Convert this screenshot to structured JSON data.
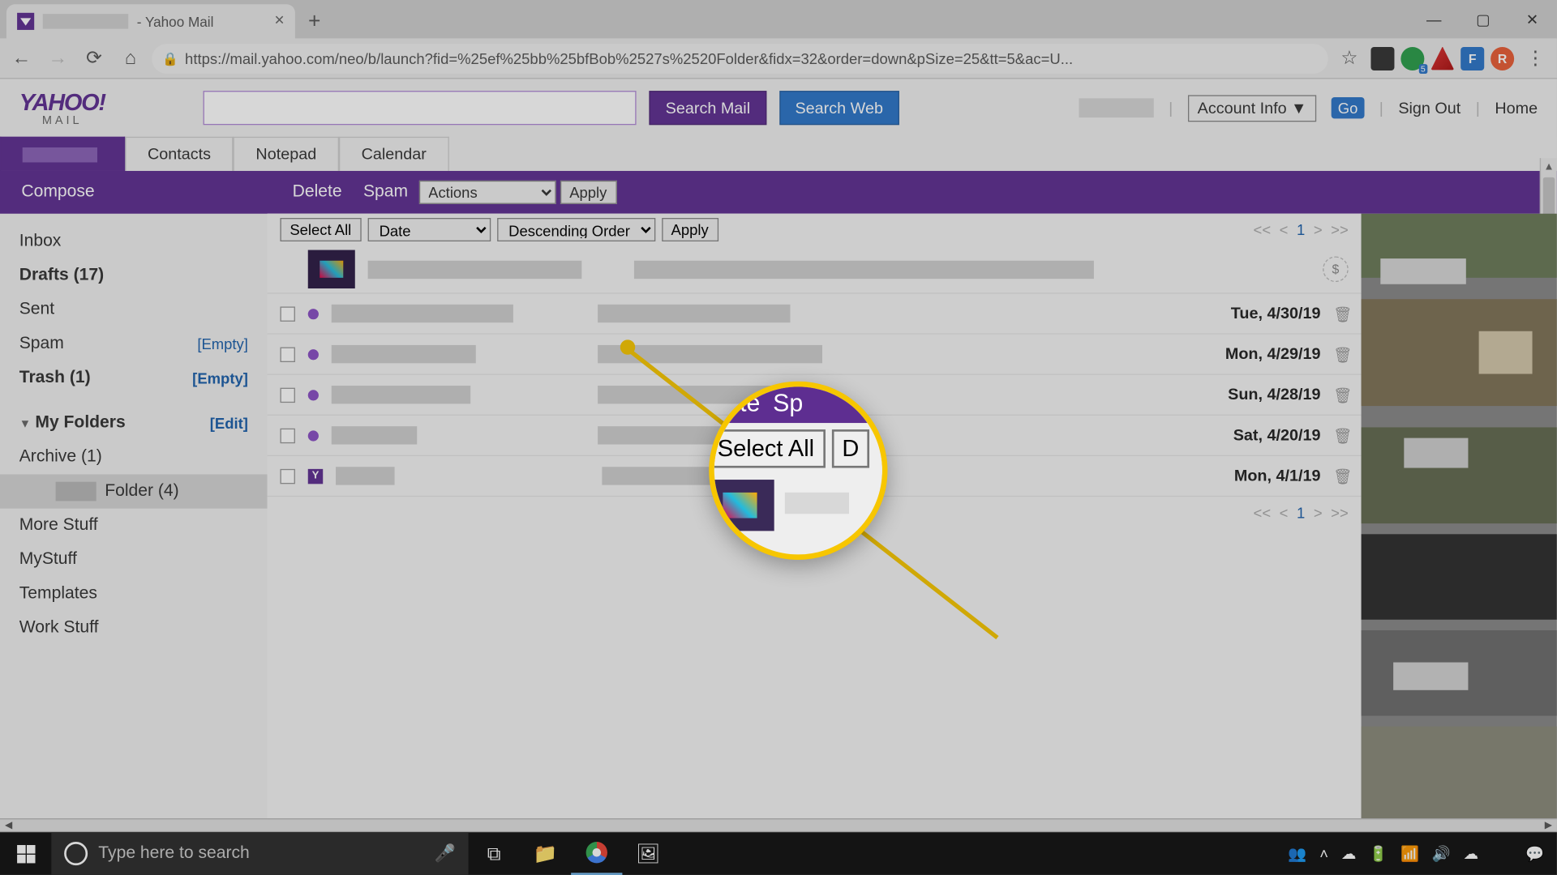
{
  "browser": {
    "tab_title": "- Yahoo Mail",
    "url": "https://mail.yahoo.com/neo/b/launch?fid=%25ef%25bb%25bfBob%2527s%2520Folder&fidx=32&order=down&pSize=25&tt=5&ac=U..."
  },
  "header": {
    "logo_top": "YAHOO!",
    "logo_bottom": "MAIL",
    "search_mail": "Search Mail",
    "search_web": "Search Web",
    "account_info": "Account Info",
    "go": "Go",
    "sign_out": "Sign Out",
    "home": "Home"
  },
  "tabs": {
    "contacts": "Contacts",
    "notepad": "Notepad",
    "calendar": "Calendar"
  },
  "purple_bar": {
    "compose": "Compose",
    "delete": "Delete",
    "spam": "Spam",
    "actions": "Actions",
    "apply": "Apply"
  },
  "sidebar": {
    "inbox": "Inbox",
    "drafts": "Drafts",
    "drafts_count": "(17)",
    "sent": "Sent",
    "spam": "Spam",
    "trash": "Trash",
    "trash_count": "(1)",
    "empty": "[Empty]",
    "my_folders": "My Folders",
    "edit": "[Edit]",
    "archive": "Archive (1)",
    "folder": "Folder (4)",
    "more_stuff": "More Stuff",
    "mystuff": "MyStuff",
    "templates": "Templates",
    "work_stuff": "Work Stuff"
  },
  "list_toolbar": {
    "select_all": "Select All",
    "sort_field": "Date",
    "sort_order": "Descending Order",
    "apply": "Apply"
  },
  "pager": {
    "first": "<<",
    "prev": "<",
    "page": "1",
    "next": ">",
    "last": ">>"
  },
  "messages": [
    {
      "date": ""
    },
    {
      "date": "Tue, 4/30/19"
    },
    {
      "date": "Mon, 4/29/19"
    },
    {
      "date": "Sun, 4/28/19"
    },
    {
      "date": "Sat, 4/20/19"
    },
    {
      "date": "Mon, 4/1/19"
    }
  ],
  "magnifier": {
    "delete_frag": "elete",
    "spam_frag": "Sp",
    "select_all": "Select All",
    "d_frag": "D"
  },
  "taskbar": {
    "search_placeholder": "Type here to search"
  }
}
